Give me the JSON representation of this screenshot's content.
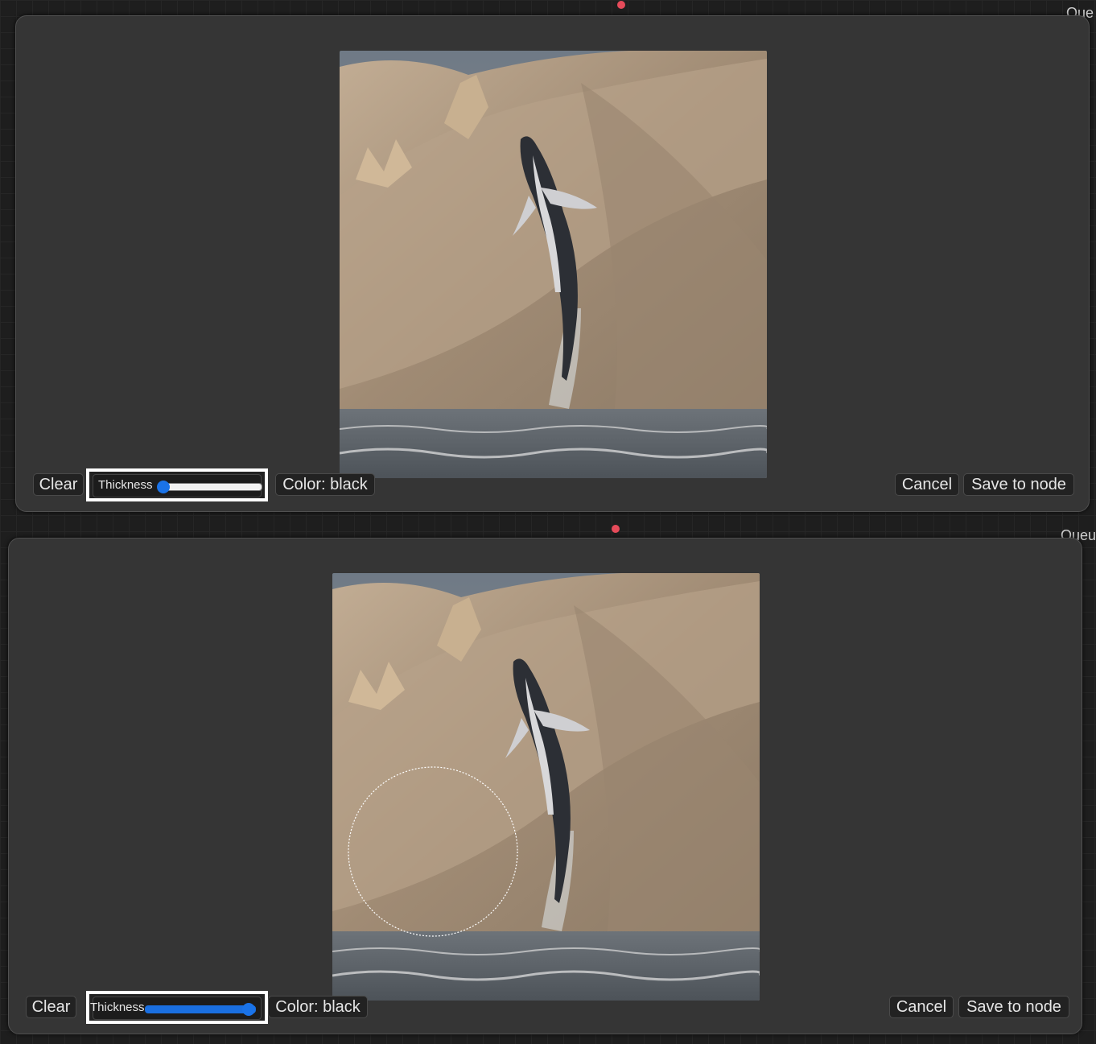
{
  "panels": [
    {
      "id": "top",
      "clear_label": "Clear",
      "thickness_label": "Thickness",
      "thickness_value": 0.05,
      "color_label": "Color: black",
      "cancel_label": "Cancel",
      "save_label": "Save to node",
      "brush_cursor_visible": false
    },
    {
      "id": "bottom",
      "clear_label": "Clear",
      "thickness_label": "Thickness",
      "thickness_value": 1.0,
      "color_label": "Color: black",
      "cancel_label": "Cancel",
      "save_label": "Save to node",
      "brush_cursor_visible": true
    }
  ],
  "background_edge": {
    "top_fragment": "Que",
    "bottom_fragment": "Queu"
  },
  "colors": {
    "panel_bg": "#353535",
    "slider_fill": "#1a6fe0",
    "highlight_box": "#ffffff",
    "node_pin": "#e64b5a"
  }
}
